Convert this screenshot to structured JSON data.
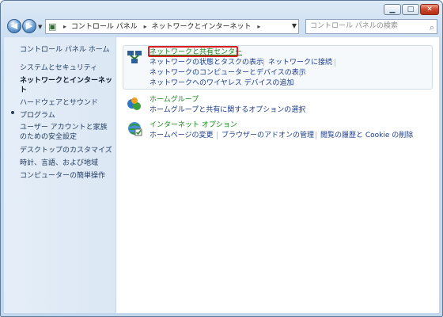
{
  "window": {
    "controls": {
      "minimize_label": "▁",
      "maximize_label": "□",
      "close_label": "✕"
    }
  },
  "navbar": {
    "back_glyph": "◀",
    "forward_glyph": "▶",
    "breadcrumbs": [
      "コントロール パネル",
      "ネットワークとインターネット"
    ],
    "search_placeholder": "コントロール パネルの検索"
  },
  "sidebar": {
    "items": [
      "コントロール パネル ホーム",
      "システムとセキュリティ",
      "ネットワークとインターネット",
      "ハードウェアとサウンド",
      "プログラム",
      "ユーザー アカウントと家族のための安全設定",
      "デスクトップのカスタマイズ",
      "時計、言語、および地域",
      "コンピューターの簡単操作"
    ],
    "current_index": 2
  },
  "categories": [
    {
      "title": "ネットワークと共有センター",
      "links": [
        "ネットワークの状態とタスクの表示",
        "ネットワークに接続",
        "ネットワークのコンピューターとデバイスの表示",
        "ネットワークへのワイヤレス デバイスの追加"
      ]
    },
    {
      "title": "ホームグループ",
      "links": [
        "ホームグループと共有に関するオプションの選択"
      ]
    },
    {
      "title": "インターネット オプション",
      "links": [
        "ホームページの変更",
        "ブラウザーのアドオンの管理",
        "閲覧の履歴と Cookie の削除"
      ]
    }
  ],
  "colors": {
    "highlight_border": "#d81e1e",
    "link": "#1a3b8a",
    "title": "#1a8a1a"
  }
}
